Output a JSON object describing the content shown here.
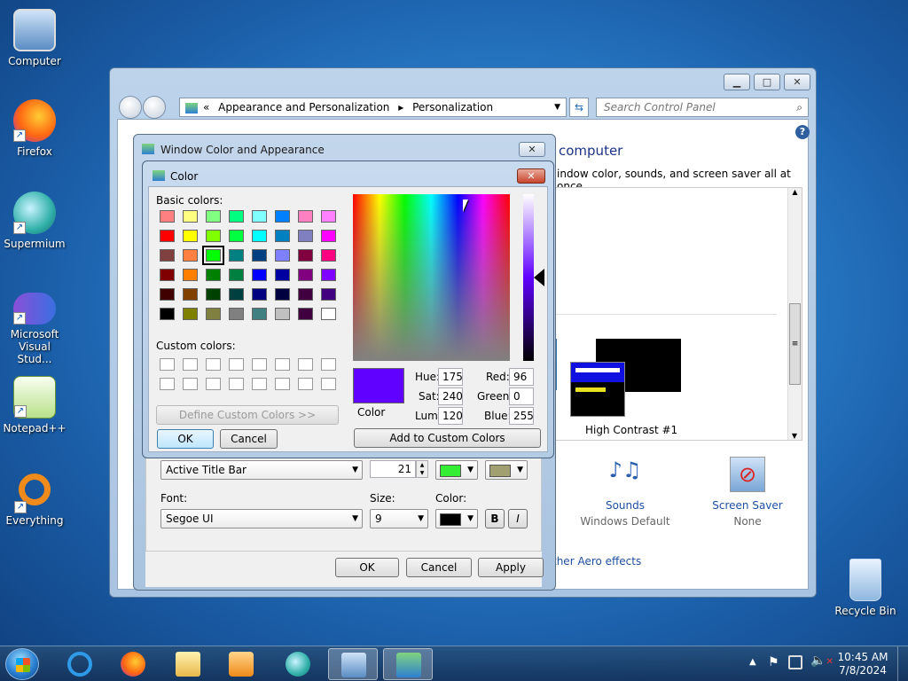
{
  "desktop": {
    "icons": [
      {
        "label": "Computer"
      },
      {
        "label": "Firefox"
      },
      {
        "label": "Supermium"
      },
      {
        "label": "Microsoft Visual Stud..."
      },
      {
        "label": "Notepad++"
      },
      {
        "label": "Everything"
      },
      {
        "label": "Recycle Bin"
      }
    ]
  },
  "control_panel": {
    "breadcrumb_prefix": "«",
    "breadcrumb_1": "Appearance and Personalization",
    "breadcrumb_sep": "▸",
    "breadcrumb_2": "Personalization",
    "search_placeholder": "Search Control Panel",
    "heading_partial": "computer",
    "subtext_partial": "indow color, sounds, and screen saver all at once.",
    "theme_name": "High Contrast #1",
    "sounds_label": "Sounds",
    "sounds_value": "Windows Default",
    "screensaver_label": "Screen Saver",
    "screensaver_value": "None",
    "aero_link": "ther Aero effects"
  },
  "window_color_dialog": {
    "title": "Window Color and Appearance",
    "item_value": "Active Title Bar",
    "size_value": "21",
    "font_label": "Font:",
    "font_value": "Segoe UI",
    "size_label": "Size:",
    "font_size_value": "9",
    "color_label": "Color:",
    "bold_label": "B",
    "italic_label": "I",
    "ok": "OK",
    "cancel": "Cancel",
    "apply": "Apply"
  },
  "color_dialog": {
    "title": "Color",
    "basic_colors_label": "Basic colors:",
    "custom_colors_label": "Custom colors:",
    "define_custom": "Define Custom Colors >>",
    "ok": "OK",
    "cancel": "Cancel",
    "add_custom": "Add to Custom Colors",
    "color_solid_label": "Color",
    "hue_label": "Hue:",
    "hue": "175",
    "sat_label": "Sat:",
    "sat": "240",
    "lum_label": "Lum:",
    "lum": "120",
    "red_label": "Red:",
    "red": "96",
    "green_label": "Green:",
    "green": "0",
    "blue_label": "Blue:",
    "blue": "255",
    "current_color": "#6000ff",
    "basic_colors": [
      [
        "#ff8080",
        "#ffff80",
        "#80ff80",
        "#00ff80",
        "#80ffff",
        "#0080ff",
        "#ff80c0",
        "#ff80ff"
      ],
      [
        "#ff0000",
        "#ffff00",
        "#80ff00",
        "#00ff40",
        "#00ffff",
        "#0080c0",
        "#8080c0",
        "#ff00ff"
      ],
      [
        "#804040",
        "#ff8040",
        "#00ff00",
        "#008080",
        "#004080",
        "#8080ff",
        "#800040",
        "#ff0080"
      ],
      [
        "#800000",
        "#ff8000",
        "#008000",
        "#008040",
        "#0000ff",
        "#0000a0",
        "#800080",
        "#8000ff"
      ],
      [
        "#400000",
        "#804000",
        "#004000",
        "#004040",
        "#000080",
        "#000040",
        "#400040",
        "#400080"
      ],
      [
        "#000000",
        "#808000",
        "#808040",
        "#808080",
        "#408080",
        "#c0c0c0",
        "#400040",
        "#ffffff"
      ]
    ]
  },
  "taskbar": {
    "time": "10:45 AM",
    "date": "7/8/2024"
  },
  "colors": {
    "active_title_color1": "#33ee33",
    "active_title_color2": "#a0a070",
    "font_color": "#000000"
  }
}
